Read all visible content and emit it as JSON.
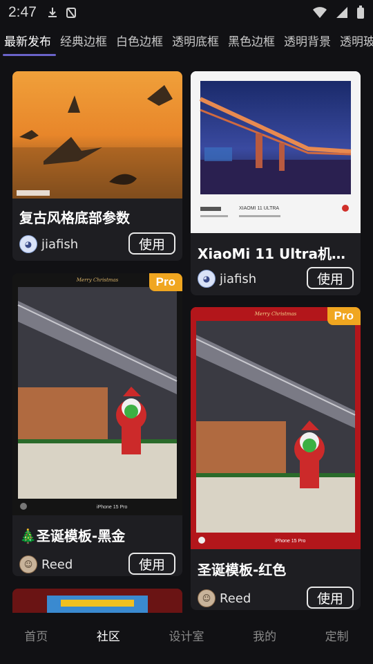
{
  "status_bar": {
    "time": "2:47"
  },
  "tabs": [
    "最新发布",
    "经典边框",
    "白色边框",
    "透明底框",
    "黑色边框",
    "透明背景",
    "透明玻"
  ],
  "active_tab": 0,
  "cards": [
    {
      "title": "复古风格底部参数",
      "author": "jiafish",
      "button": "使用",
      "pro": false
    },
    {
      "title": "XiaoMi 11 Ultra机型...",
      "author": "jiafish",
      "button": "使用",
      "pro": false,
      "thumb_caption": "XIAOMI 11 ULTRA"
    },
    {
      "title": "🎄圣诞模板-黑金",
      "author": "Reed",
      "button": "使用",
      "pro": true,
      "badge": "Pro",
      "banner": "Merry Christmas",
      "footer_text": "iPhone 15 Pro"
    },
    {
      "title": "圣诞模板-红色",
      "author": "Reed",
      "button": "使用",
      "pro": true,
      "badge": "Pro",
      "banner": "Merry Christmas",
      "footer_text": "iPhone 15 Pro"
    }
  ],
  "bottom_nav": [
    "首页",
    "社区",
    "设计室",
    "我的",
    "定制"
  ],
  "active_nav": 1,
  "colors": {
    "background": "#111114",
    "card": "#1e1e22",
    "pro_badge": "#f0a620",
    "tab_underline": "#6a63c9"
  }
}
